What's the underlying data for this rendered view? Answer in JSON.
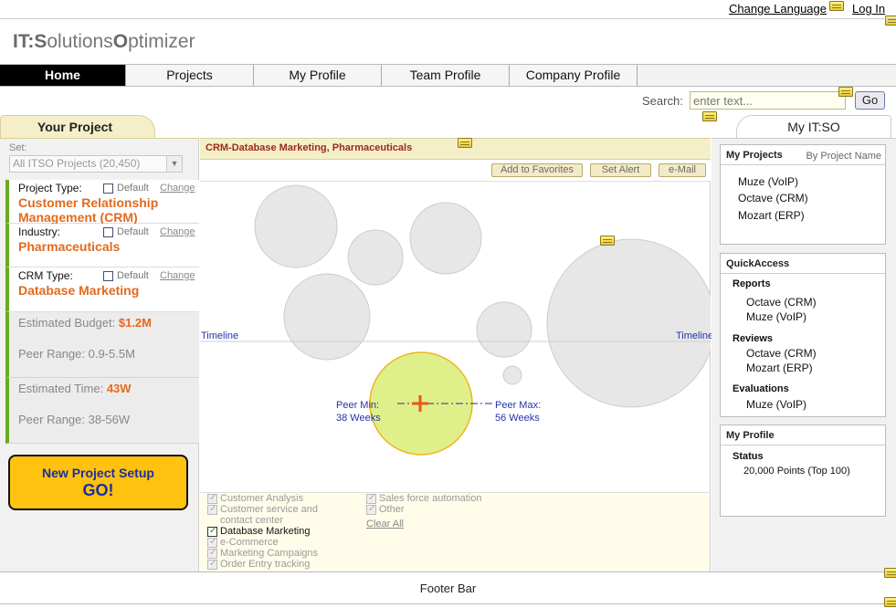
{
  "top_links": {
    "change_language": "Change Language",
    "log_in": "Log In"
  },
  "logo": {
    "p1": "IT:",
    "p2": "S",
    "p3": "olutions",
    "p4": "O",
    "p5": "ptimizer"
  },
  "nav": {
    "tabs": [
      "Home",
      "Projects",
      "My Profile",
      "Team Profile",
      "Company Profile"
    ],
    "active": "Home"
  },
  "search": {
    "label": "Search:",
    "placeholder": "enter text...",
    "button": "Go"
  },
  "left": {
    "tab_title": "Your Project",
    "set_label": "Set:",
    "set_value": "All ITSO Projects (20,450)",
    "fields": [
      {
        "label": "Project Type:",
        "value1": "Customer Relationship",
        "value2": "Management (CRM)",
        "default": "Default",
        "change": "Change"
      },
      {
        "label": "Industry:",
        "value1": "Pharmaceuticals",
        "default": "Default",
        "change": "Change"
      },
      {
        "label": "CRM Type:",
        "value1": "Database Marketing",
        "default": "Default",
        "change": "Change"
      }
    ],
    "budget": {
      "label": "Estimated Budget:",
      "value": "$1.2M",
      "peer": "Peer Range: 0.9-5.5M"
    },
    "time": {
      "label": "Estimated Time:",
      "value": "43W",
      "peer": "Peer Range: 38-56W"
    },
    "go_button": {
      "line1": "New Project Setup",
      "line2": "GO!"
    }
  },
  "center": {
    "title": "CRM-Database Marketing, Pharmaceuticals",
    "actions": [
      "Add to Favorites",
      "Set Alert",
      "e-Mail"
    ],
    "timeline_left": "Timeline",
    "timeline_right": "Timeline",
    "peer_min": {
      "label": "Peer Min:",
      "value": "38 Weeks"
    },
    "peer_max": {
      "label": "Peer Max:",
      "value": "56  Weeks"
    },
    "filters_col1": [
      {
        "label": "Customer Analysis",
        "checked": false
      },
      {
        "label": "Customer service and contact center",
        "checked": false
      },
      {
        "label": "Database Marketing",
        "checked": true
      },
      {
        "label": "e-Commerce",
        "checked": false
      },
      {
        "label": "Marketing Campaigns",
        "checked": false
      },
      {
        "label": "Order Entry tracking",
        "checked": false
      }
    ],
    "filters_col2": [
      {
        "label": "Sales force automation",
        "checked": false
      },
      {
        "label": "Other",
        "checked": false
      }
    ],
    "clear_all": "Clear All"
  },
  "right": {
    "tab_title": "My IT:SO",
    "my_projects": {
      "title": "My Projects",
      "sub": "By Project Name",
      "items": [
        "Muze (VoIP)",
        "Octave (CRM)",
        "Mozart (ERP)"
      ]
    },
    "quick_access": {
      "title": "QuickAccess",
      "reports": {
        "label": "Reports",
        "items": [
          "Octave (CRM)",
          "Muze (VoIP)"
        ]
      },
      "reviews": {
        "label": "Reviews",
        "items": [
          "Octave (CRM)",
          "Mozart (ERP)"
        ]
      },
      "evaluations": {
        "label": "Evaluations",
        "items": [
          "Muze (VoIP)"
        ]
      }
    },
    "my_profile": {
      "title": "My Profile",
      "status_label": "Status",
      "status_value": "20,000 Points (Top 100)"
    }
  },
  "footer": {
    "text": "Footer Bar"
  },
  "colors": {
    "accent_orange": "#e36a1d",
    "nav_active": "#000000",
    "go_yellow": "#ffc20f",
    "highlight_green": "#dff08a",
    "panel_cream": "#f5efc9"
  }
}
